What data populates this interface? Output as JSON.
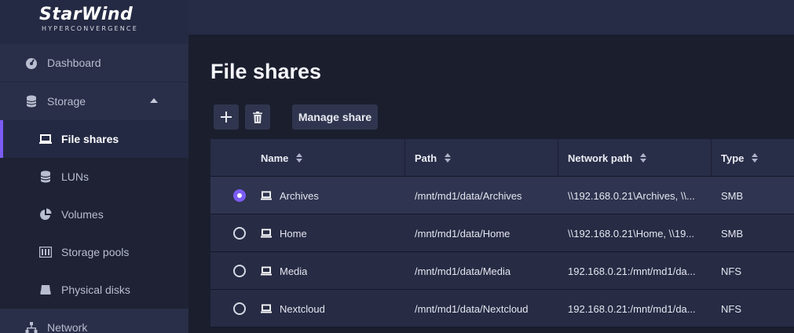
{
  "brand": {
    "name": "StarWind",
    "tagline": "HYPERCONVERGENCE"
  },
  "sidebar": {
    "items": [
      {
        "label": "Dashboard",
        "icon": "gauge-icon"
      },
      {
        "label": "Storage",
        "icon": "database-icon",
        "expanded": true
      },
      {
        "label": "File shares",
        "icon": "folder-icon",
        "active": true
      },
      {
        "label": "LUNs",
        "icon": "database-icon"
      },
      {
        "label": "Volumes",
        "icon": "pie-chart-icon"
      },
      {
        "label": "Storage pools",
        "icon": "columns-icon"
      },
      {
        "label": "Physical disks",
        "icon": "disk-icon"
      },
      {
        "label": "Network",
        "icon": "network-icon"
      }
    ]
  },
  "page": {
    "title": "File shares"
  },
  "toolbar": {
    "add_icon": "plus-icon",
    "delete_icon": "trash-icon",
    "manage_label": "Manage share"
  },
  "table": {
    "columns": [
      "Name",
      "Path",
      "Network path",
      "Type"
    ],
    "rows": [
      {
        "name": "Archives",
        "path": "/mnt/md1/data/Archives",
        "network_path": "\\\\192.168.0.21\\Archives, \\\\...",
        "type": "SMB",
        "selected": true
      },
      {
        "name": "Home",
        "path": "/mnt/md1/data/Home",
        "network_path": "\\\\192.168.0.21\\Home, \\\\19...",
        "type": "SMB",
        "selected": false
      },
      {
        "name": "Media",
        "path": "/mnt/md1/data/Media",
        "network_path": "192.168.0.21:/mnt/md1/da...",
        "type": "NFS",
        "selected": false
      },
      {
        "name": "Nextcloud",
        "path": "/mnt/md1/data/Nextcloud",
        "network_path": "192.168.0.21:/mnt/md1/da...",
        "type": "NFS",
        "selected": false
      }
    ]
  },
  "colors": {
    "accent": "#7b5cf5",
    "sidebar_bg": "#232840",
    "main_bg": "#1b1e2d"
  }
}
